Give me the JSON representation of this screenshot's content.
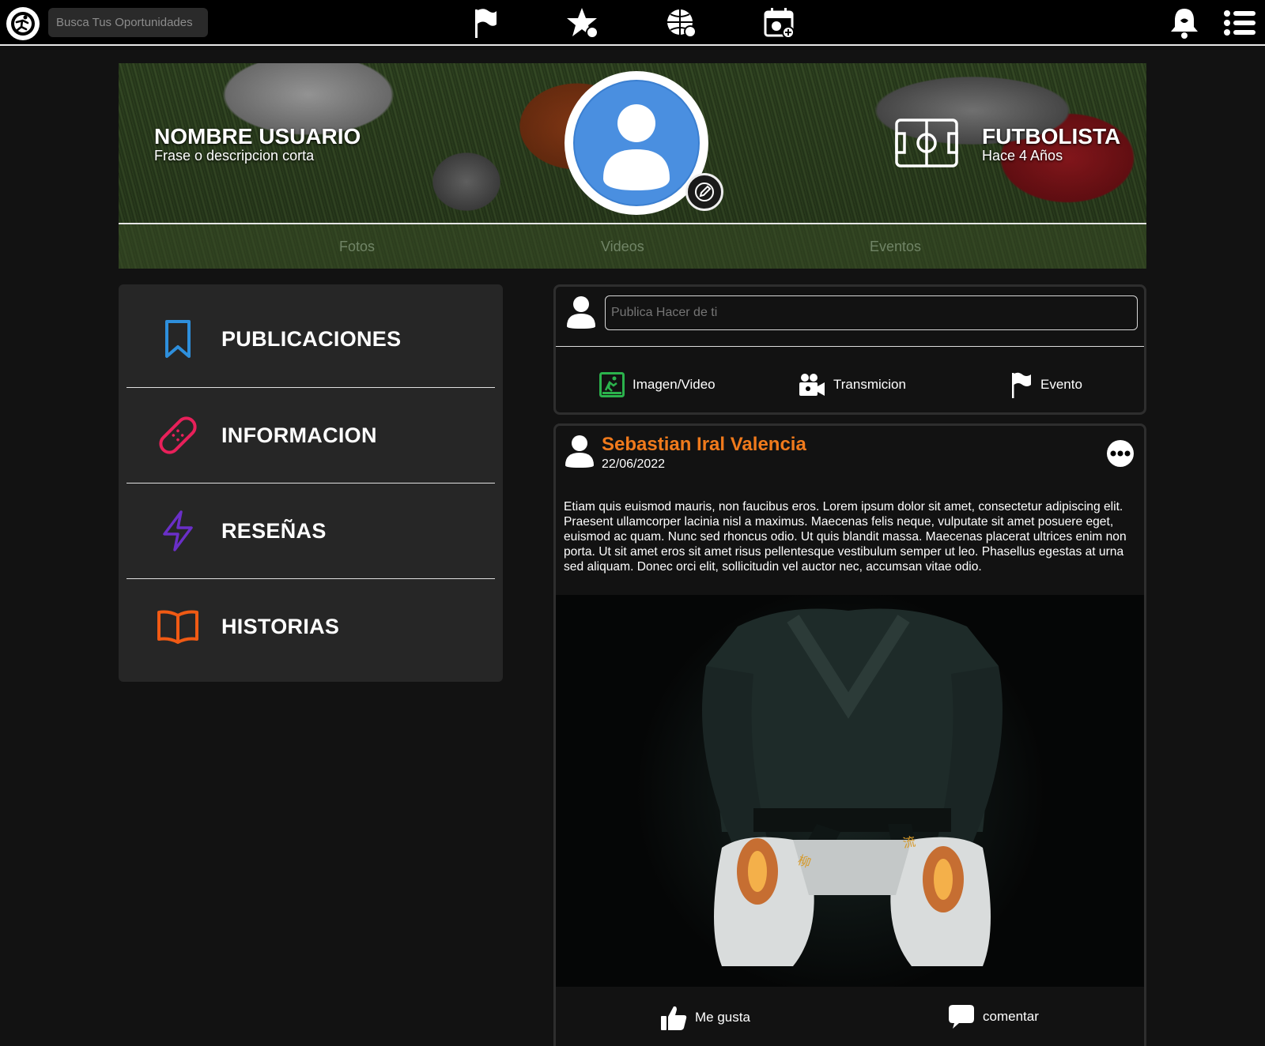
{
  "topbar": {
    "search_placeholder": "Busca Tus Oportunidades",
    "nav_icons": [
      "flag-icon",
      "star-icon",
      "sports-globe-icon",
      "calendar-add-icon"
    ],
    "right_icons": [
      "bell-icon",
      "menu-list-icon"
    ]
  },
  "profile": {
    "name": "NOMBRE USUARIO",
    "phrase": "Frase o descripcion corta",
    "sport": "FUTBOLISTA",
    "sport_time": "Hace 4 Años",
    "tabs": [
      "Fotos",
      "Videos",
      "Eventos"
    ]
  },
  "sidebar": {
    "items": [
      {
        "label": "PUBLICACIONES",
        "icon": "bookmark-icon",
        "color": "#2e8fdc"
      },
      {
        "label": "INFORMACION",
        "icon": "bandage-icon",
        "color": "#e8205a"
      },
      {
        "label": "RESEÑAS",
        "icon": "lightning-icon",
        "color": "#6a2fc8"
      },
      {
        "label": "HISTORIAS",
        "icon": "open-book-icon",
        "color": "#f05a14"
      }
    ]
  },
  "composer": {
    "placeholder": "Publica Hacer de ti",
    "actions": {
      "media": "Imagen/Video",
      "stream": "Transmicion",
      "event": "Evento"
    }
  },
  "post": {
    "author": "Sebastian Iral Valencia",
    "date": "22/06/2022",
    "text": "Etiam quis euismod mauris, non faucibus eros. Lorem ipsum dolor sit amet, consectetur adipiscing elit. Praesent ullamcorper lacinia nisl a maximus. Maecenas felis neque, vulputate sit amet posuere eget, euismod ac quam. Nunc sed rhoncus odio. Ut quis blandit massa. Maecenas placerat ultrices enim non porta. Ut sit amet eros sit amet risus pellentesque vestibulum semper ut leo. Phasellus egestas at urna sed aliquam. Donec orci elit, sollicitudin vel auctor nec, accumsan vitae odio.",
    "like": "Me gusta",
    "comment": "comentar"
  },
  "colors": {
    "accent_orange": "#f07a1c",
    "media_green": "#2bb24c"
  }
}
